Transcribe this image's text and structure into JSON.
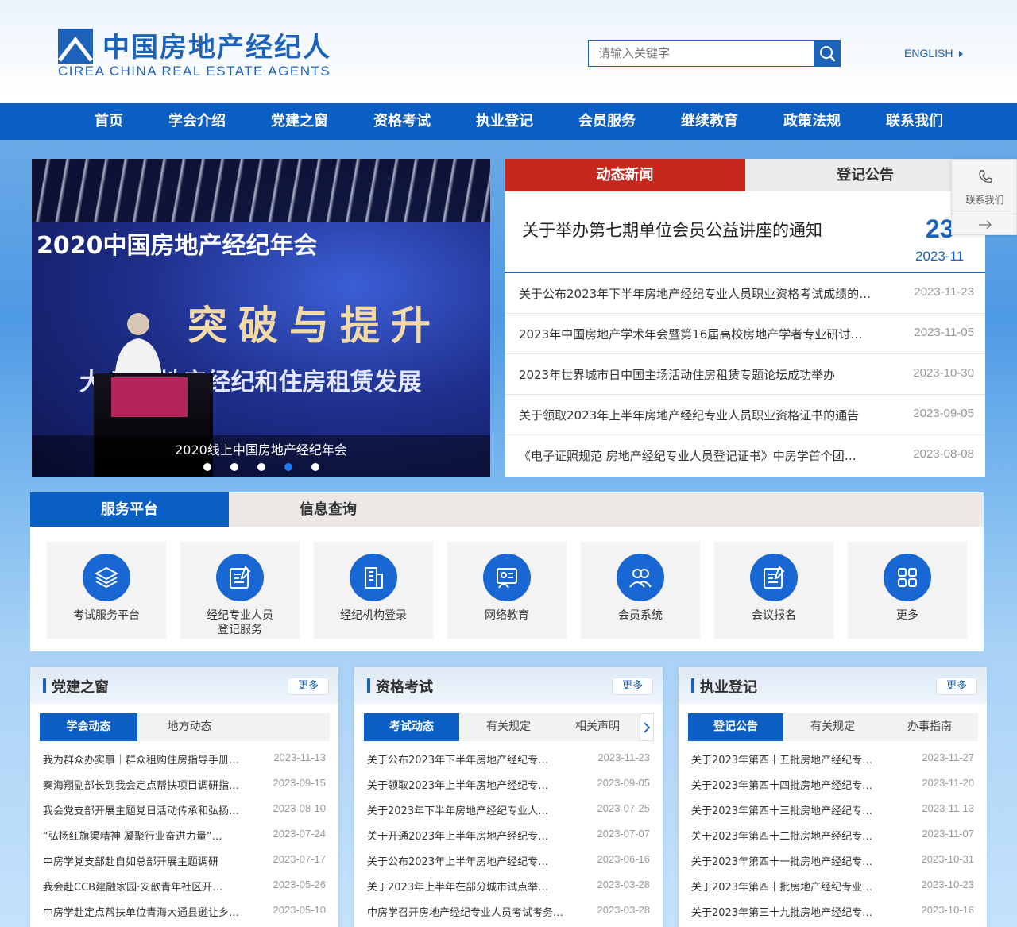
{
  "header": {
    "logo_cn": "中国房地产经纪人",
    "logo_en": "CIREA  CHINA REAL ESTATE AGENTS",
    "search_placeholder": "请输入关键字",
    "english_link": "ENGLISH"
  },
  "nav": [
    "首页",
    "学会介绍",
    "党建之窗",
    "资格考试",
    "执业登记",
    "会员服务",
    "继续教育",
    "政策法规",
    "联系我们"
  ],
  "carousel": {
    "caption": "2020线上中国房地产经纪年会",
    "slide_title": "2020中国房地产经纪年会",
    "slide_big": "突破与提升",
    "slide_sub": "大    下房地产经纪和住房租赁发展",
    "dots": 5,
    "active_dot": 4
  },
  "news": {
    "tabs": [
      "动态新闻",
      "登记公告"
    ],
    "headline": {
      "title": "关于举办第七期单位会员公益讲座的通知",
      "day": "23",
      "month": "2023-11"
    },
    "items": [
      {
        "title": "关于公布2023年下半年房地产经纪专业人员职业资格考试成绩的…",
        "date": "2023-11-23"
      },
      {
        "title": "2023年中国房地产学术年会暨第16届高校房地产学者专业研讨…",
        "date": "2023-11-05"
      },
      {
        "title": "2023年世界城市日中国主场活动住房租赁专题论坛成功举办",
        "date": "2023-10-30"
      },
      {
        "title": "关于领取2023年上半年房地产经纪专业人员职业资格证书的通告",
        "date": "2023-09-05"
      },
      {
        "title": "《电子证照规范 房地产经纪专业人员登记证书》中房学首个团…",
        "date": "2023-08-08"
      }
    ]
  },
  "side_contact": {
    "label": "联系我们"
  },
  "service": {
    "tabs": [
      "服务平台",
      "信息查询"
    ],
    "tiles": [
      {
        "label": "考试服务平台",
        "icon": "layers-icon"
      },
      {
        "label": "经纪专业人员\n登记服务",
        "icon": "certificate-edit-icon"
      },
      {
        "label": "经纪机构登录",
        "icon": "building-icon"
      },
      {
        "label": "网络教育",
        "icon": "online-education-icon"
      },
      {
        "label": "会员系统",
        "icon": "members-icon"
      },
      {
        "label": "会议报名",
        "icon": "register-form-icon"
      },
      {
        "label": "更多",
        "icon": "grid-more-icon"
      }
    ]
  },
  "panels": [
    {
      "title": "党建之窗",
      "more": "更多",
      "tabs": [
        "学会动态",
        "地方动态"
      ],
      "items": [
        {
          "title": "我为群众办实事｜群众租购住房指导手册…",
          "date": "2023-11-13"
        },
        {
          "title": "秦海翔副部长到我会定点帮扶项目调研指…",
          "date": "2023-09-15"
        },
        {
          "title": "我会党支部开展主题党日活动传承和弘扬…",
          "date": "2023-08-10"
        },
        {
          "title": "“弘扬红旗渠精神 凝聚行业奋进力量”…",
          "date": "2023-07-24"
        },
        {
          "title": "中房学党支部赴自如总部开展主题调研",
          "date": "2023-07-17"
        },
        {
          "title": "我会赴CCB建融家园·安歆青年社区开…",
          "date": "2023-05-26"
        },
        {
          "title": "中房学赴定点帮扶单位青海大通县逊让乡…",
          "date": "2023-05-10"
        }
      ]
    },
    {
      "title": "资格考试",
      "more": "更多",
      "tabs": [
        "考试动态",
        "有关规定",
        "相关声明"
      ],
      "items": [
        {
          "title": "关于公布2023年下半年房地产经纪专…",
          "date": "2023-11-23"
        },
        {
          "title": "关于领取2023年上半年房地产经纪专…",
          "date": "2023-09-05"
        },
        {
          "title": "关于2023年下半年房地产经纪专业人…",
          "date": "2023-07-25"
        },
        {
          "title": "关于开通2023年上半年房地产经纪专…",
          "date": "2023-07-07"
        },
        {
          "title": "关于公布2023年上半年房地产经纪专…",
          "date": "2023-06-16"
        },
        {
          "title": "关于2023年上半年在部分城市试点举…",
          "date": "2023-03-28"
        },
        {
          "title": "中房学召开房地产经纪专业人员考试考务…",
          "date": "2023-03-28"
        }
      ]
    },
    {
      "title": "执业登记",
      "more": "更多",
      "tabs": [
        "登记公告",
        "有关规定",
        "办事指南"
      ],
      "items": [
        {
          "title": "关于2023年第四十五批房地产经纪专…",
          "date": "2023-11-27"
        },
        {
          "title": "关于2023年第四十四批房地产经纪专…",
          "date": "2023-11-20"
        },
        {
          "title": "关于2023年第四十三批房地产经纪专…",
          "date": "2023-11-13"
        },
        {
          "title": "关于2023年第四十二批房地产经纪专…",
          "date": "2023-11-07"
        },
        {
          "title": "关于2023年第四十一批房地产经纪专…",
          "date": "2023-10-31"
        },
        {
          "title": "关于2023年第四十批房地产经纪专业…",
          "date": "2023-10-23"
        },
        {
          "title": "关于2023年第三十九批房地产经纪专…",
          "date": "2023-10-16"
        }
      ]
    }
  ],
  "colors": {
    "primary": "#0a5ec4",
    "news_active": "#c6281b",
    "brand": "#1c62b9"
  }
}
